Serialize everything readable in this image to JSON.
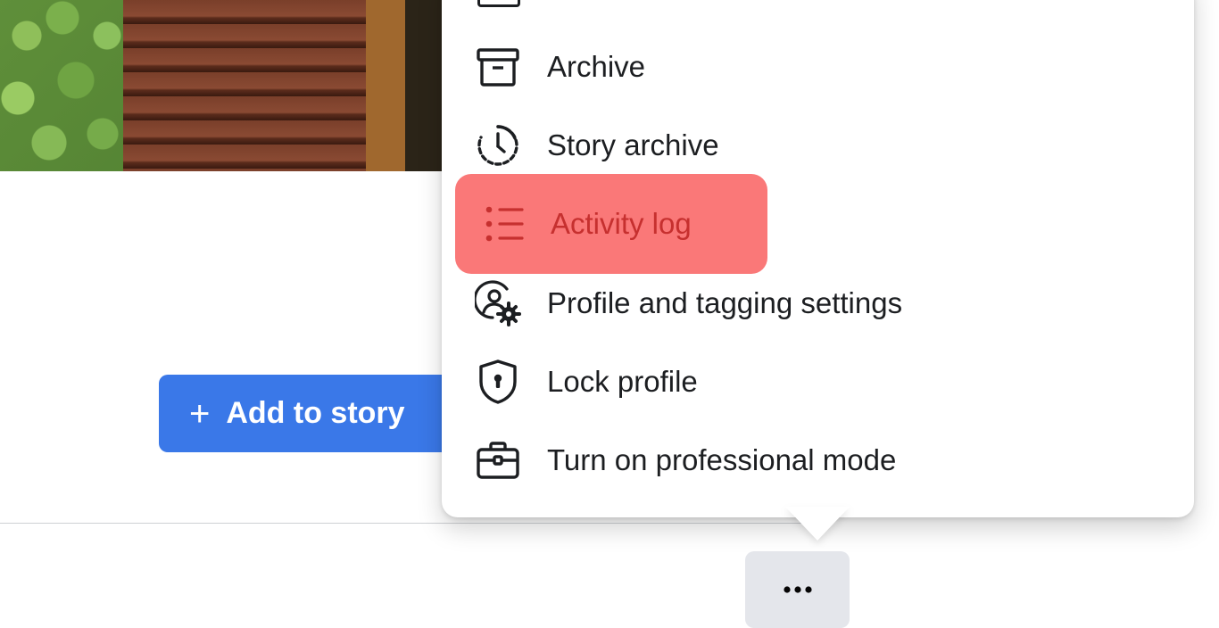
{
  "story_button": {
    "plus": "+",
    "label": "Add to story"
  },
  "menu": {
    "items": [
      {
        "label": "Archive",
        "icon": "archive-box-icon"
      },
      {
        "label": "Story archive",
        "icon": "clock-history-icon"
      },
      {
        "label": "Activity log",
        "icon": "list-icon",
        "highlighted": true
      },
      {
        "label": "Profile and tagging settings",
        "icon": "user-settings-icon"
      },
      {
        "label": "Lock profile",
        "icon": "shield-lock-icon"
      },
      {
        "label": "Turn on professional mode",
        "icon": "briefcase-icon"
      }
    ]
  },
  "colors": {
    "primary": "#3a78e8",
    "highlight": "#fa7878",
    "highlight_text": "#c6302f"
  }
}
